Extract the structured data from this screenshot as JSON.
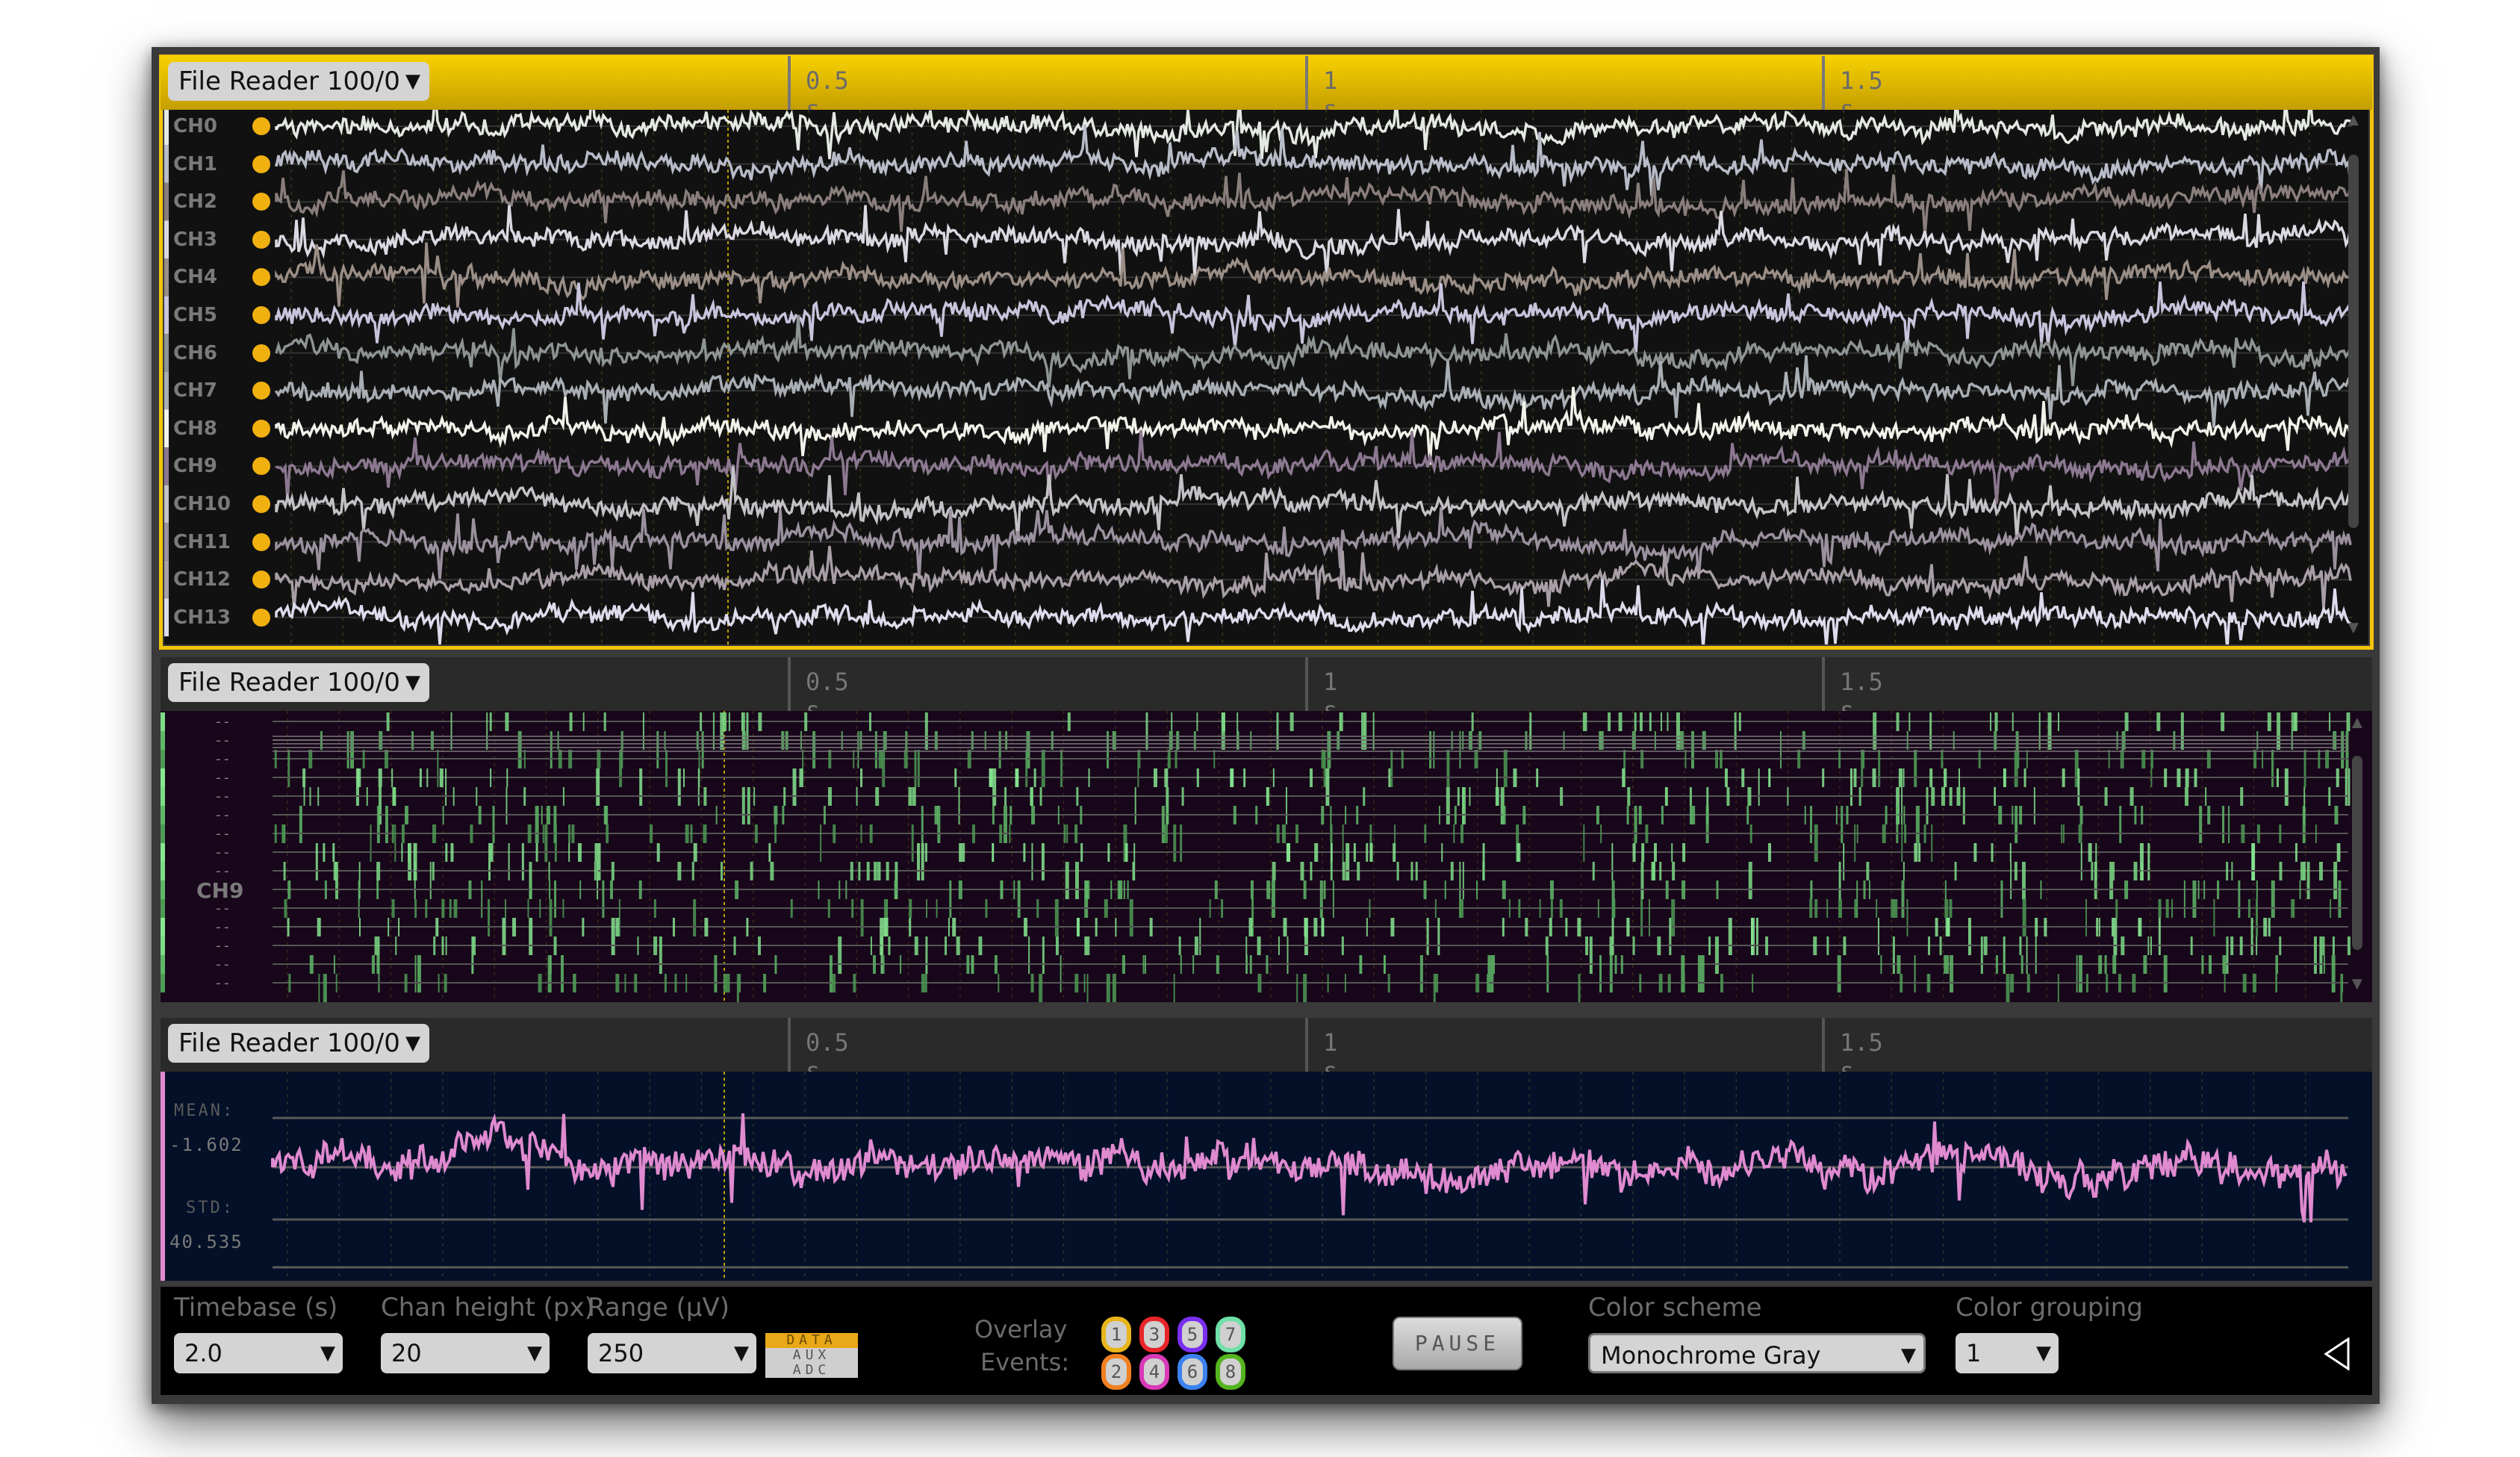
{
  "panels": [
    {
      "source": "File Reader 100/0",
      "ticks": [
        "0.5 s",
        "1 s",
        "1.5 s"
      ],
      "selected": true,
      "view": "traces",
      "channels": [
        "CH0",
        "CH1",
        "CH2",
        "CH3",
        "CH4",
        "CH5",
        "CH6",
        "CH7",
        "CH8",
        "CH9",
        "CH10",
        "CH11",
        "CH12",
        "CH13"
      ],
      "channel_colors": [
        "#e4e8e2",
        "#b8bcc8",
        "#8a7e7c",
        "#dcd8e2",
        "#9a8e86",
        "#c8c4dc",
        "#8e9494",
        "#a8aeb4",
        "#f2f2ea",
        "#8c7890",
        "#c4c2c6",
        "#9a909e",
        "#a89ea6",
        "#dcdcec"
      ],
      "indicator_color": "#f0b010"
    },
    {
      "source": "File Reader 100/0",
      "ticks": [
        "0.5 s",
        "1 s",
        "1.5 s"
      ],
      "selected": false,
      "view": "spike-raster",
      "channel_label": "CH9",
      "row_marker": "--",
      "accent": "#6fd07a"
    },
    {
      "source": "File Reader 100/0",
      "ticks": [
        "0.5 s",
        "1 s",
        "1.5 s"
      ],
      "selected": false,
      "view": "single-channel",
      "mean_label": "MEAN:",
      "mean_value": "-1.602",
      "std_label": "STD:",
      "std_value": "40.535",
      "trace_color": "#e08ad0"
    }
  ],
  "controls": {
    "timebase": {
      "label": "Timebase (s)",
      "value": "2.0"
    },
    "chan_height": {
      "label": "Chan height (px)",
      "value": "20"
    },
    "range": {
      "label": "Range (µV)",
      "value": "250"
    },
    "range_types": [
      {
        "label": "DATA",
        "active": true
      },
      {
        "label": "AUX",
        "active": false
      },
      {
        "label": "ADC",
        "active": false
      }
    ],
    "overlay_label_1": "Overlay",
    "overlay_label_2": "Events:",
    "events": [
      {
        "n": "1",
        "color": "#e8b51c"
      },
      {
        "n": "3",
        "color": "#e8262a"
      },
      {
        "n": "5",
        "color": "#7b2ff0"
      },
      {
        "n": "7",
        "color": "#6fe0a8"
      },
      {
        "n": "2",
        "color": "#f08022"
      },
      {
        "n": "4",
        "color": "#d83ab8"
      },
      {
        "n": "6",
        "color": "#3c82f0"
      },
      {
        "n": "8",
        "color": "#55b420"
      }
    ],
    "pause_label": "PAUSE",
    "color_scheme": {
      "label": "Color scheme",
      "value": "Monochrome Gray"
    },
    "color_grouping": {
      "label": "Color grouping",
      "value": "1"
    },
    "collapse_icon": "triangle-left-icon"
  }
}
